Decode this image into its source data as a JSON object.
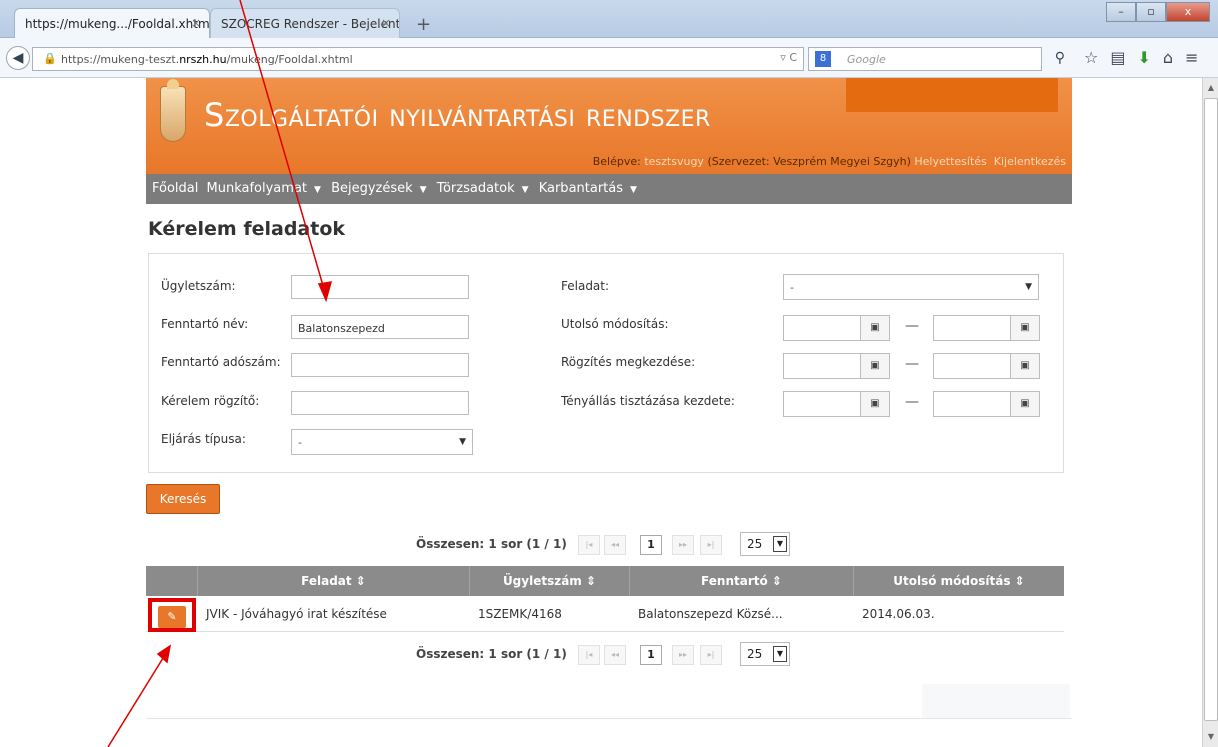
{
  "browser": {
    "tabs": [
      {
        "title": "https://mukeng.../Fooldal.xhtml",
        "close": "×"
      },
      {
        "title": "SZOCREG Rendszer - Bejelentk...",
        "close": "×"
      }
    ],
    "new_tab": "+",
    "window_buttons": {
      "minimize": "–",
      "maximize": "▫",
      "close": "x"
    },
    "url_prefix": "https://mukeng-teszt.",
    "url_host": "nrszh.hu",
    "url_path": "/mukeng/Fooldal.xhtml",
    "url_icons": "▿ C",
    "search_placeholder": "Google",
    "search_engine": "8"
  },
  "app": {
    "title": "Szolgáltatói nyilvántartási rendszer",
    "header_accent": "#e56b10",
    "userbar": {
      "logged_in_label": "Belépve:",
      "username": "tesztsvugy",
      "organization": "(Szervezet: Veszprém Megyei Szgyh)",
      "deputy_link": "Helyettesítés",
      "logout_link": "Kijelentkezés"
    },
    "menu": [
      {
        "label": "Főoldal",
        "dropdown": false
      },
      {
        "label": "Munkafolyamat",
        "dropdown": true
      },
      {
        "label": "Bejegyzések",
        "dropdown": true
      },
      {
        "label": "Törzsadatok",
        "dropdown": true
      },
      {
        "label": "Karbantartás",
        "dropdown": true
      }
    ]
  },
  "page": {
    "title": "Kérelem feladatok",
    "filters": {
      "case_number": {
        "label": "Ügyletszám:",
        "value": ""
      },
      "maintainer_name": {
        "label": "Fenntartó név:",
        "value": "Balatonszepezd"
      },
      "maintainer_tax": {
        "label": "Fenntartó adószám:",
        "value": ""
      },
      "request_recorder": {
        "label": "Kérelem rögzítő:",
        "value": ""
      },
      "procedure_type": {
        "label": "Eljárás típusa:",
        "value": "-"
      },
      "task": {
        "label": "Feladat:",
        "value": "-"
      },
      "last_modified": {
        "label": "Utolsó módosítás:",
        "from": "",
        "to": ""
      },
      "recording_start": {
        "label": "Rögzítés megkezdése:",
        "from": "",
        "to": ""
      },
      "fact_clarification": {
        "label": "Tényállás tisztázása kezdete:",
        "from": "",
        "to": ""
      }
    },
    "search_button": "Keresés",
    "pager": {
      "summary": "Összesen: 1 sor (1 / 1)",
      "first": "|◂",
      "prev": "◂◂",
      "current": "1",
      "next": "▸▸",
      "last": "▸|",
      "per_page": "25"
    },
    "table": {
      "columns": [
        "Feladat ⇕",
        "Ügyletszám ⇕",
        "Fenntartó ⇕",
        "Utolsó módosítás ⇕"
      ],
      "rows": [
        {
          "task": "JVIK - Jóváhagyó irat készítése",
          "case_number": "1SZEMK/4168",
          "maintainer": "Balatonszepezd Közsé...",
          "last_modified": "2014.06.03."
        }
      ]
    }
  }
}
